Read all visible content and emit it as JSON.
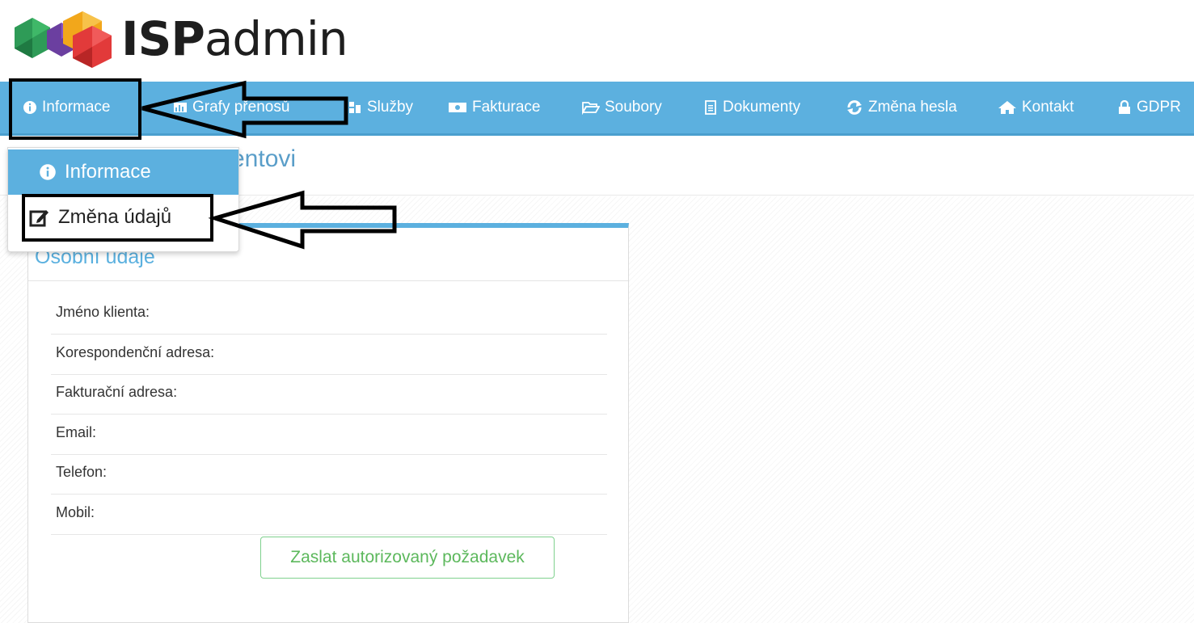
{
  "logo": {
    "brand_bold": "ISP",
    "brand_light": "admin"
  },
  "nav": {
    "items": [
      {
        "label": "Informace",
        "icon": "info-circle-icon"
      },
      {
        "label": "Grafy přenosů",
        "icon": "bar-chart-icon"
      },
      {
        "label": "Služby",
        "icon": "sitemap-icon"
      },
      {
        "label": "Fakturace",
        "icon": "money-icon"
      },
      {
        "label": "Soubory",
        "icon": "folder-open-icon"
      },
      {
        "label": "Dokumenty",
        "icon": "file-text-icon"
      },
      {
        "label": "Změna hesla",
        "icon": "refresh-icon"
      },
      {
        "label": "Kontakt",
        "icon": "home-icon"
      },
      {
        "label": "GDPR",
        "icon": "lock-icon"
      }
    ]
  },
  "page": {
    "title_visible": "entovi"
  },
  "dropdown": {
    "items": [
      {
        "label": "Informace",
        "icon": "info-circle-icon"
      },
      {
        "label": "Změna údajů",
        "icon": "edit-icon"
      }
    ]
  },
  "panel": {
    "title": "Osobní údaje",
    "fields": [
      {
        "label": "Jméno klienta:"
      },
      {
        "label": "Korespondenční adresa:"
      },
      {
        "label": "Fakturační adresa:"
      },
      {
        "label": "Email:"
      },
      {
        "label": "Telefon:"
      },
      {
        "label": "Mobil:"
      }
    ],
    "submit_label": "Zaslat autorizovaný požadavek"
  },
  "colors": {
    "nav_bg": "#5cb0df",
    "accent_blue": "#5ab0df",
    "button_green": "#5cb85c",
    "annotation": "#000000"
  }
}
